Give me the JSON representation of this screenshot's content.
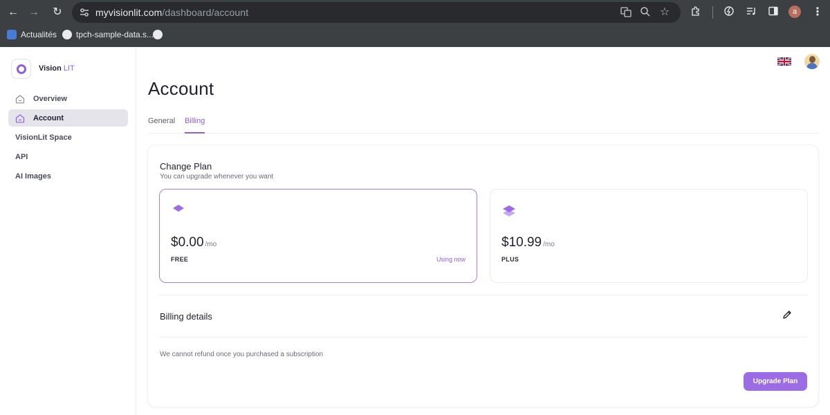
{
  "browser": {
    "url_host": "myvisionlit.com",
    "url_path": "/dashboard/account",
    "profile_initial": "a",
    "bookmarks": [
      {
        "label": "Actualités"
      },
      {
        "label": "tpch-sample-data.s..."
      },
      {
        "label": ""
      }
    ]
  },
  "app": {
    "logo_name": "Vision",
    "logo_suffix": "LIT",
    "accent_color": "#8f5ee0"
  },
  "sidebar": {
    "items": [
      {
        "label": "Overview",
        "icon": "home-icon",
        "active": false
      },
      {
        "label": "Account",
        "icon": "home-icon",
        "active": true
      },
      {
        "label": "VisionLit Space",
        "active": false
      },
      {
        "label": "API",
        "active": false
      },
      {
        "label": "AI Images",
        "active": false
      }
    ]
  },
  "main": {
    "title": "Account",
    "tabs": [
      {
        "label": "General",
        "active": false
      },
      {
        "label": "Billing",
        "active": true
      }
    ],
    "change_plan": {
      "title": "Change Plan",
      "subtitle": "You can upgrade whenever you want",
      "plans": [
        {
          "price": "$0.00",
          "per": "/mo",
          "name": "FREE",
          "status": "Using now",
          "selected": true
        },
        {
          "price": "$10.99",
          "per": "/mo",
          "name": "PLUS",
          "status": "",
          "selected": false
        }
      ]
    },
    "billing": {
      "title": "Billing details",
      "refund_note": "We cannot refund once you purchased a subscription",
      "upgrade_label": "Upgrade Plan"
    }
  }
}
